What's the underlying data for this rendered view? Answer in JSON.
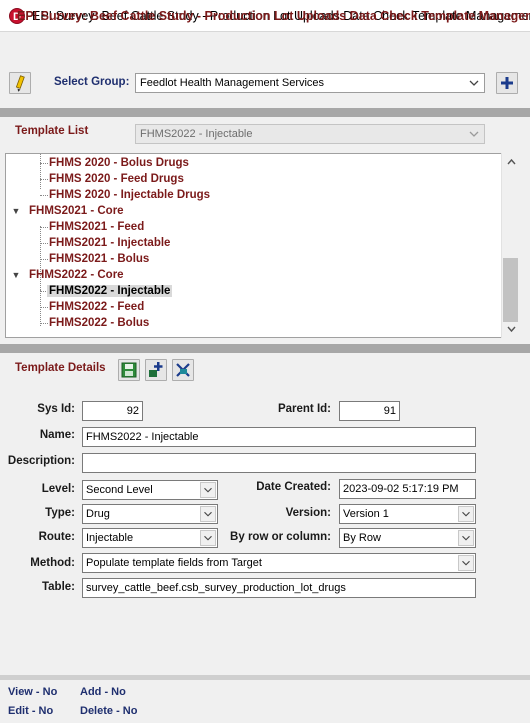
{
  "window": {
    "title": "EPI Survey: Beef Cattle Study - Production Lot Uploads Data Check Template Management",
    "app_icon_letter": "D"
  },
  "header": {
    "title": "EPI Survey: Beef Cattle Study - Production Lot Uploads Data Check Template Management"
  },
  "toolbar": {
    "select_group_label": "Select Group:",
    "group_value": "Feedlot Health Management Services"
  },
  "template_list": {
    "label": "Template List",
    "selected_value": "FHMS2022 - Injectable",
    "tree": [
      {
        "label": "FHMS 2020 - Bolus Drugs"
      },
      {
        "label": "FHMS 2020 - Feed Drugs"
      },
      {
        "label": "FHMS 2020 - Injectable Drugs"
      },
      {
        "label": "FHMS2021 - Core"
      },
      {
        "label": "FHMS2021 - Feed"
      },
      {
        "label": "FHMS2021 - Injectable"
      },
      {
        "label": "FHMS2021 - Bolus"
      },
      {
        "label": "FHMS2022 - Core"
      },
      {
        "label": "FHMS2022 - Injectable"
      },
      {
        "label": "FHMS2022 - Feed"
      },
      {
        "label": "FHMS2022 - Bolus"
      }
    ]
  },
  "details": {
    "label": "Template Details",
    "sys_id_label": "Sys Id:",
    "sys_id": "92",
    "parent_id_label": "Parent Id:",
    "parent_id": "91",
    "name_label": "Name:",
    "name": "FHMS2022 - Injectable",
    "description_label": "Description:",
    "description": "",
    "level_label": "Level:",
    "level": "Second Level",
    "date_created_label": "Date Created:",
    "date_created": "2023-09-02 5:17:19 PM",
    "type_label": "Type:",
    "type": "Drug",
    "version_label": "Version:",
    "version": "Version 1",
    "route_label": "Route:",
    "route": "Injectable",
    "by_row_label": "By row or column:",
    "by_row": "By Row",
    "method_label": "Method:",
    "method": "Populate template fields from Target",
    "table_label": "Table:",
    "table": "survey_cattle_beef.csb_survey_production_lot_drugs"
  },
  "permissions": {
    "view": "View - No",
    "add": "Add - No",
    "edit": "Edit - No",
    "delete": "Delete - No"
  },
  "colors": {
    "accent_maroon": "#7b1a1a",
    "label_navy": "#1f2f6f",
    "app_icon_red": "#c8102e"
  }
}
